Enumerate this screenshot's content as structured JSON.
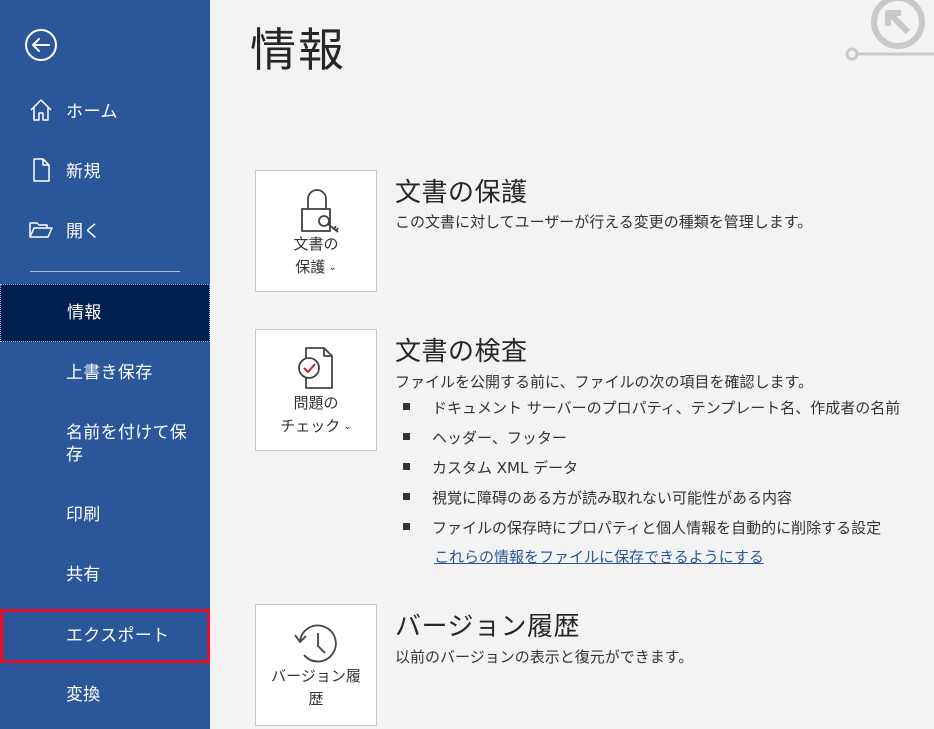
{
  "sidebar": {
    "back_label": "",
    "top_items": [
      {
        "label": "ホーム",
        "icon": "home-icon"
      },
      {
        "label": "新規",
        "icon": "new-document-icon"
      },
      {
        "label": "開く",
        "icon": "open-folder-icon"
      }
    ],
    "items": [
      {
        "label": "情報",
        "selected": true
      },
      {
        "label": "上書き保存"
      },
      {
        "label": "名前を付けて保存"
      },
      {
        "label": "印刷"
      },
      {
        "label": "共有"
      },
      {
        "label": "エクスポート",
        "highlighted": true
      },
      {
        "label": "変換"
      }
    ]
  },
  "main": {
    "title": "情報",
    "sections": [
      {
        "tile_label_line1": "文書の",
        "tile_label_line2": "保護",
        "tile_icon": "lock-key-icon",
        "title": "文書の保護",
        "description": "この文書に対してユーザーが行える変更の種類を管理します。"
      },
      {
        "tile_label_line1": "問題の",
        "tile_label_line2": "チェック",
        "tile_icon": "document-check-icon",
        "title": "文書の検査",
        "description": "ファイルを公開する前に、ファイルの次の項目を確認します。",
        "bullets": [
          "ドキュメント サーバーのプロパティ、テンプレート名、作成者の名前",
          "ヘッダー、フッター",
          "カスタム XML データ",
          "視覚に障碍のある方が読み取れない可能性がある内容",
          "ファイルの保存時にプロパティと個人情報を自動的に削除する設定"
        ],
        "link": "これらの情報をファイルに保存できるようにする"
      },
      {
        "tile_label_line1": "バージョン履",
        "tile_label_line2": "歴",
        "tile_icon": "version-history-icon",
        "title": "バージョン履歴",
        "description": "以前のバージョンの表示と復元ができます。"
      }
    ]
  },
  "colors": {
    "sidebar_bg": "#2b579a",
    "sidebar_selected_bg": "#002050",
    "highlight_border": "#e0132a",
    "link": "#2b579a",
    "main_bg": "#f3f3f3"
  }
}
